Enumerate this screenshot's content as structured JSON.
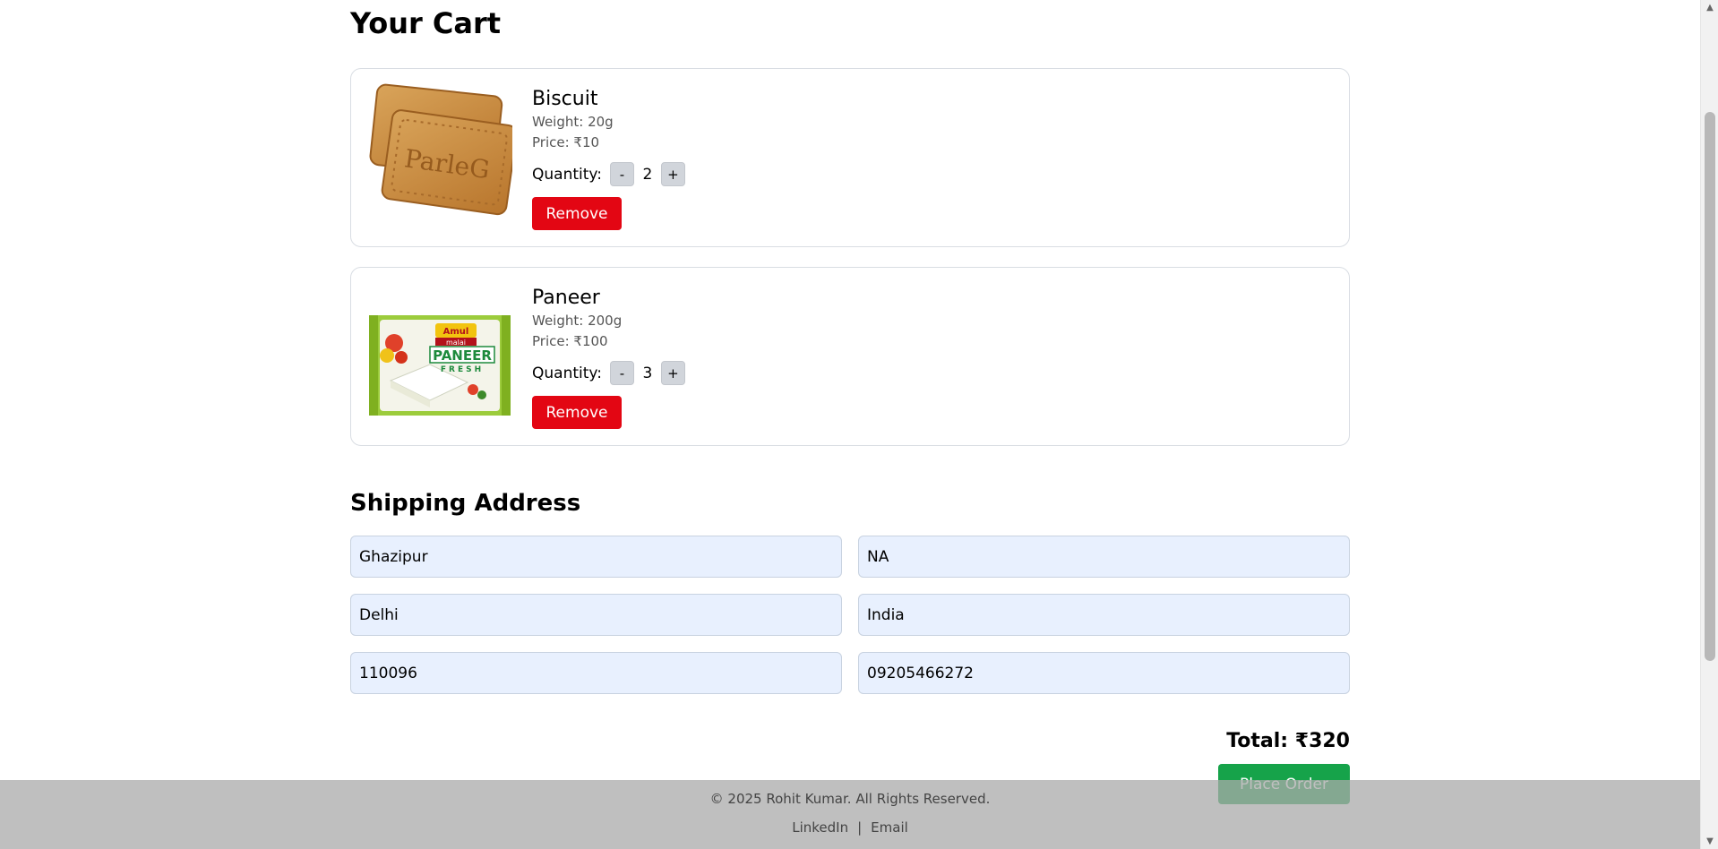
{
  "cart": {
    "title": "Your Cart",
    "items": [
      {
        "name": "Biscuit",
        "weight": "Weight: 20g",
        "price": "Price: ₹10",
        "quantity_label": "Quantity:",
        "quantity": "2",
        "minus": "-",
        "plus": "+",
        "remove": "Remove",
        "image_icon": "biscuit-image"
      },
      {
        "name": "Paneer",
        "weight": "Weight: 200g",
        "price": "Price: ₹100",
        "quantity_label": "Quantity:",
        "quantity": "3",
        "minus": "-",
        "plus": "+",
        "remove": "Remove",
        "image_icon": "paneer-package-image",
        "package_brand": "Amul",
        "package_sub": "malai",
        "package_title": "PANEER",
        "package_tag": "FRESH"
      }
    ]
  },
  "shipping": {
    "title": "Shipping Address",
    "fields": [
      "Ghazipur",
      "NA",
      "Delhi",
      "India",
      "110096",
      "09205466272"
    ]
  },
  "summary": {
    "total": "Total: ₹320",
    "place_order": "Place Order"
  },
  "footer": {
    "copyright": "© 2025 Rohit Kumar. All Rights Reserved.",
    "links": [
      "LinkedIn",
      "Email"
    ],
    "separator": "|"
  },
  "colors": {
    "remove": "#e30613",
    "place_order": "#16a34a",
    "input_bg": "#e8f0fe",
    "footer_bg": "#bdbdbd"
  }
}
